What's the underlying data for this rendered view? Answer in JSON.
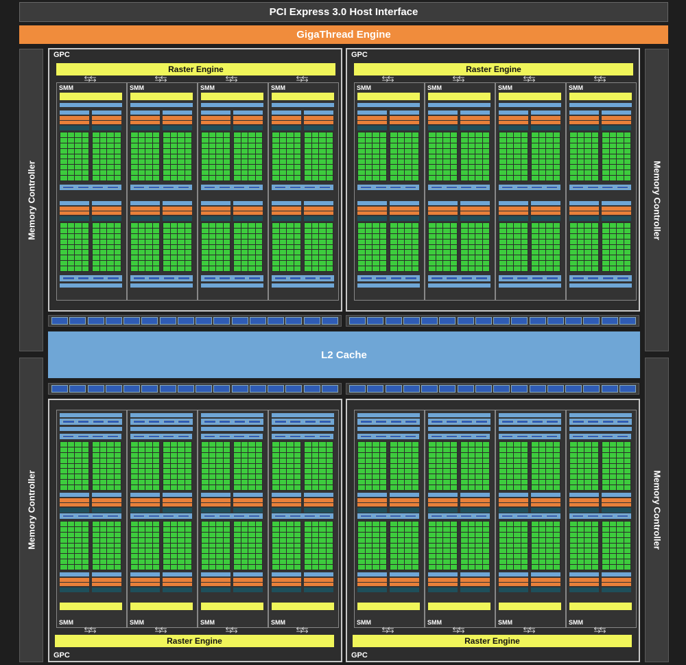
{
  "header": {
    "pci": "PCI Express 3.0 Host Interface",
    "giga": "GigaThread Engine"
  },
  "memory_controller_label": "Memory Controller",
  "l2_label": "L2 Cache",
  "gpc_label": "GPC",
  "raster_label": "Raster Engine",
  "smm_label": "SMM",
  "colors": {
    "core": "#3dcc3d",
    "raster": "#f0f55a",
    "giga": "#f08c3c",
    "cache": "#6fa6d6"
  }
}
